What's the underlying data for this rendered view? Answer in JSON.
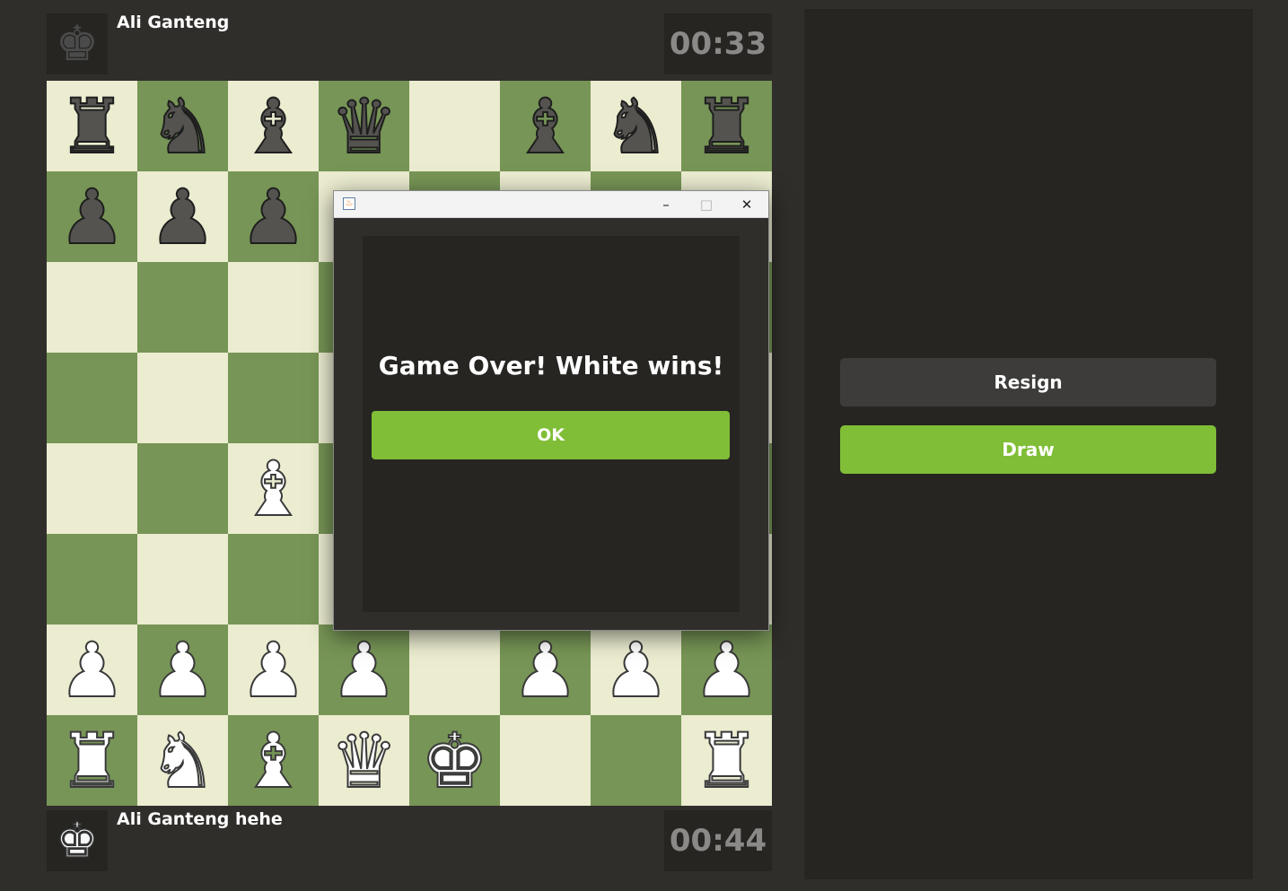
{
  "top_player": {
    "name": "Ali Ganteng",
    "clock": "00:33",
    "avatar_icon": "black-king-icon"
  },
  "bottom_player": {
    "name": "Ali Ganteng hehe",
    "clock": "00:44",
    "avatar_icon": "white-king-icon"
  },
  "board": {
    "light_color": "#ebecd0",
    "dark_color": "#779556",
    "ranks": [
      [
        "br",
        "bn",
        "bb",
        "bq",
        "",
        "bb",
        "bn",
        "br"
      ],
      [
        "bp",
        "bp",
        "bp",
        "",
        "",
        "",
        "",
        ""
      ],
      [
        "",
        "",
        "",
        "",
        "",
        "",
        "",
        ""
      ],
      [
        "",
        "",
        "",
        "",
        "",
        "",
        "",
        ""
      ],
      [
        "",
        "",
        "wb",
        "",
        "",
        "",
        "",
        ""
      ],
      [
        "",
        "",
        "",
        "",
        "",
        "",
        "",
        ""
      ],
      [
        "wp",
        "wp",
        "wp",
        "wp",
        "",
        "wp",
        "wp",
        "wp"
      ],
      [
        "wr",
        "wn",
        "wb",
        "wq",
        "wk",
        "",
        "",
        "wr"
      ]
    ]
  },
  "side_panel": {
    "resign_label": "Resign",
    "draw_label": "Draw"
  },
  "dialog": {
    "app_icon": "java-icon",
    "minimize_glyph": "–",
    "maximize_glyph": "□",
    "close_glyph": "✕",
    "message": "Game Over! White wins!",
    "ok_label": "OK"
  },
  "colors": {
    "background": "#302e2b",
    "panel": "#262522",
    "accent_green": "#7fbe36",
    "resign_gray": "#3d3c3a"
  }
}
